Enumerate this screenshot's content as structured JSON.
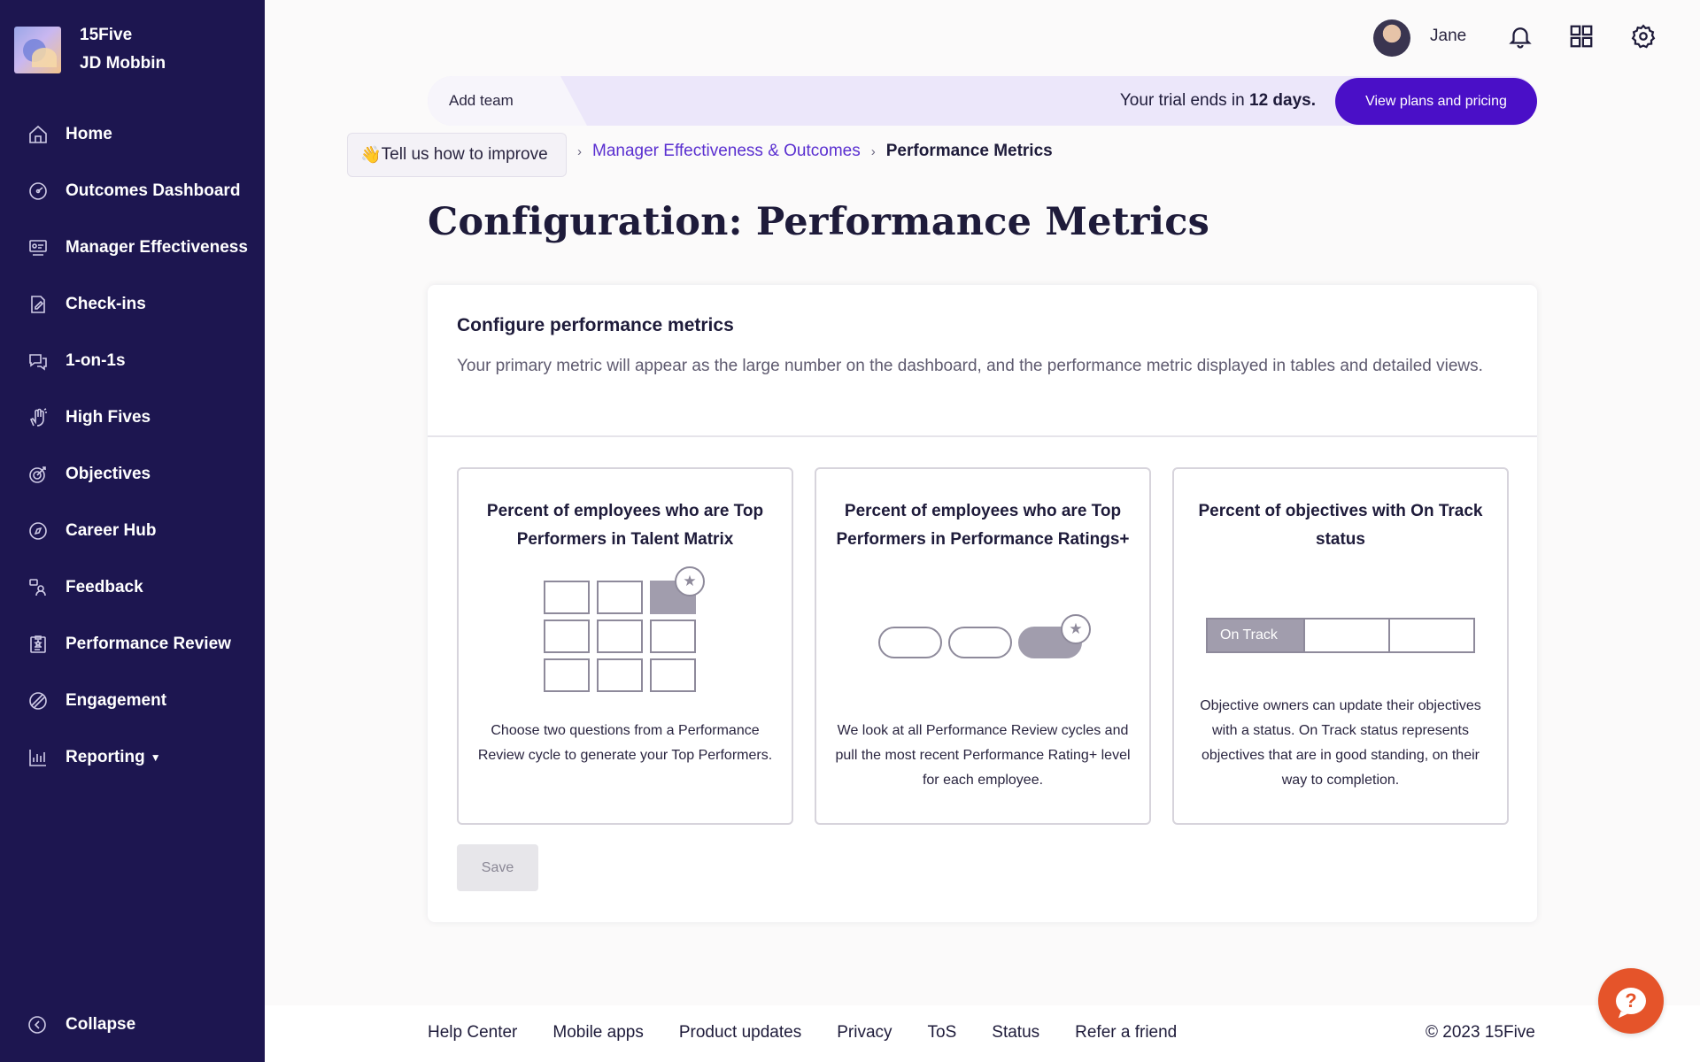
{
  "org": {
    "name": "15Five",
    "user": "JD Mobbin"
  },
  "sidebar": {
    "items": [
      {
        "label": "Home",
        "icon": "home-icon"
      },
      {
        "label": "Outcomes Dashboard",
        "icon": "dashboard-icon"
      },
      {
        "label": "Manager Effectiveness",
        "icon": "manager-icon"
      },
      {
        "label": "Check-ins",
        "icon": "checkin-icon"
      },
      {
        "label": "1-on-1s",
        "icon": "chat-icon"
      },
      {
        "label": "High Fives",
        "icon": "high-five-icon"
      },
      {
        "label": "Objectives",
        "icon": "target-icon"
      },
      {
        "label": "Career Hub",
        "icon": "compass-icon"
      },
      {
        "label": "Feedback",
        "icon": "feedback-icon"
      },
      {
        "label": "Performance Review",
        "icon": "review-icon"
      },
      {
        "label": "Engagement",
        "icon": "engagement-icon"
      },
      {
        "label": "Reporting",
        "icon": "chart-icon"
      }
    ],
    "collapse_label": "Collapse"
  },
  "topbar": {
    "user_name": "Jane"
  },
  "trial": {
    "add_team": "Add team",
    "text_prefix": "Your trial ends in",
    "days": "12 days.",
    "button": "View plans and pricing"
  },
  "breadcrumb": {
    "improve": "Tell us how to improve",
    "improve_emoji": "👋",
    "link": "Manager Effectiveness & Outcomes",
    "current": "Performance Metrics"
  },
  "page": {
    "title": "Configuration: Performance Metrics"
  },
  "card": {
    "title": "Configure performance metrics",
    "description": "Your primary metric will appear as the large number on the dashboard, and the performance metric displayed in tables and detailed views.",
    "options": [
      {
        "title": "Percent of employees who are Top Performers in Talent Matrix",
        "description": "Choose two questions from a Performance Review cycle to generate your Top Performers."
      },
      {
        "title": "Percent of employees who are Top Performers in Performance Ratings+",
        "description": "We look at all Performance Review cycles and pull the most recent Performance Rating+ level for each employee."
      },
      {
        "title": "Percent of objectives with On Track status",
        "status_label": "On Track",
        "description": "Objective owners can update their objectives with a status. On Track status represents objectives that are in good standing, on their way to completion."
      }
    ],
    "save_label": "Save"
  },
  "footer": {
    "links": [
      "Help Center",
      "Mobile apps",
      "Product updates",
      "Privacy",
      "ToS",
      "Status",
      "Refer a friend"
    ],
    "copyright": "© 2023 15Five"
  },
  "colors": {
    "sidebar": "#1d1650",
    "accent": "#4a0fc7",
    "link": "#5a2fd0",
    "fab": "#e5542a"
  }
}
